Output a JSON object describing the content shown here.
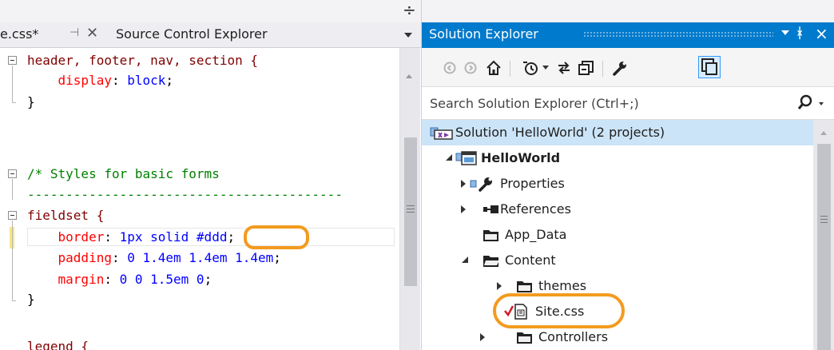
{
  "editor": {
    "tabs": [
      {
        "label": "e.css*",
        "pin_glyph": "⊣",
        "close_glyph": "✕"
      },
      {
        "label": "Source Control Explorer"
      }
    ],
    "code_lines": [
      [
        {
          "t": "header, footer, nav, section {",
          "c": "kw"
        }
      ],
      [
        {
          "t": "    ",
          "c": "pn"
        },
        {
          "t": "display",
          "c": "prop"
        },
        {
          "t": ": ",
          "c": "pn"
        },
        {
          "t": "block",
          "c": "val"
        },
        {
          "t": ";",
          "c": "pn"
        }
      ],
      [
        {
          "t": "}",
          "c": "pn"
        }
      ],
      [
        {
          "t": "",
          "c": "pn"
        }
      ],
      [
        {
          "t": "",
          "c": "pn"
        }
      ],
      [
        {
          "t": "/* Styles for basic forms",
          "c": "cm"
        }
      ],
      [
        {
          "t": "-----------------------------------------",
          "c": "cm"
        }
      ],
      [
        {
          "t": "fieldset {",
          "c": "kw"
        }
      ],
      [
        {
          "t": "    ",
          "c": "pn"
        },
        {
          "t": "border",
          "c": "prop"
        },
        {
          "t": ": ",
          "c": "pn"
        },
        {
          "t": "1px solid #ddd",
          "c": "val"
        },
        {
          "t": ";",
          "c": "pn"
        }
      ],
      [
        {
          "t": "    ",
          "c": "pn"
        },
        {
          "t": "padding",
          "c": "prop"
        },
        {
          "t": ": ",
          "c": "pn"
        },
        {
          "t": "0 1.4em 1.4em 1.4em",
          "c": "val"
        },
        {
          "t": ";",
          "c": "pn"
        }
      ],
      [
        {
          "t": "    ",
          "c": "pn"
        },
        {
          "t": "margin",
          "c": "prop"
        },
        {
          "t": ": ",
          "c": "pn"
        },
        {
          "t": "0 0 1.5em 0",
          "c": "val"
        },
        {
          "t": ";",
          "c": "pn"
        }
      ],
      [
        {
          "t": "}",
          "c": "pn"
        }
      ],
      [
        {
          "t": "",
          "c": "pn"
        }
      ],
      [
        {
          "t": "legend {",
          "c": "kw"
        }
      ]
    ]
  },
  "solution_explorer": {
    "title": "Solution Explorer",
    "search_placeholder": "Search Solution Explorer (Ctrl+;)",
    "toolbar": [
      "back-icon",
      "forward-icon",
      "home-icon",
      "history-icon",
      "sync-icon",
      "collapse-all-icon",
      "properties-icon",
      "show-all-files-icon"
    ],
    "tree": [
      {
        "label": "Solution 'HelloWorld' (2 projects)",
        "icon": "solution-icon",
        "selected": true
      },
      {
        "label": "HelloWorld",
        "icon": "web-project-icon",
        "expander": "open",
        "bold": true
      },
      {
        "label": "Properties",
        "icon": "wrench-icon",
        "expander": "closed"
      },
      {
        "label": "References",
        "icon": "references-icon",
        "expander": "closed"
      },
      {
        "label": "App_Data",
        "icon": "folder-icon"
      },
      {
        "label": "Content",
        "icon": "folder-open-icon",
        "expander": "open"
      },
      {
        "label": "themes",
        "icon": "folder-icon",
        "expander": "closed"
      },
      {
        "label": "Site.css",
        "icon": "css-file-icon",
        "status": "checked-out"
      },
      {
        "label": "Controllers",
        "icon": "folder-icon",
        "expander": "closed"
      }
    ]
  },
  "colors": {
    "accent": "#007acc",
    "highlight_ring": "#f39b1f",
    "selection": "#cce4f7"
  }
}
